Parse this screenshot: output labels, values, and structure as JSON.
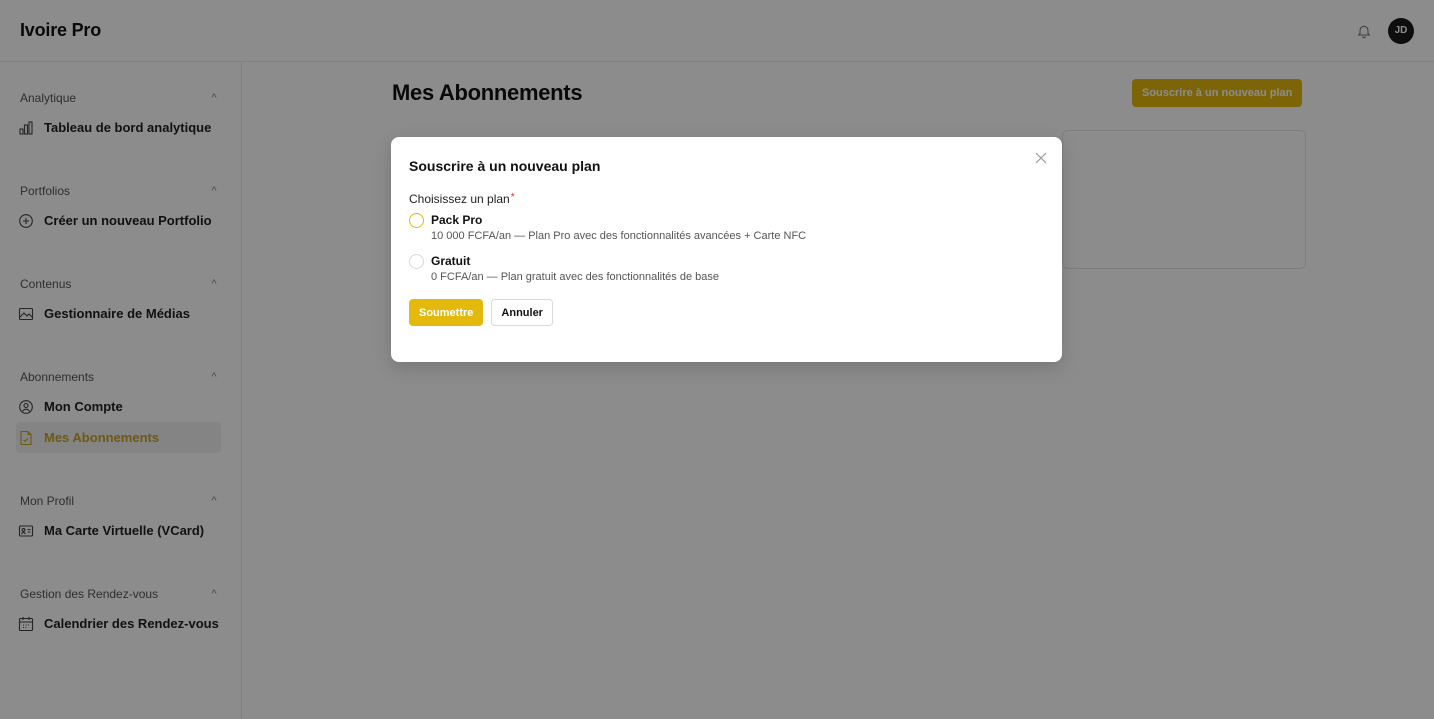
{
  "app": {
    "brand": "Ivoire Pro",
    "avatar_initials": "JD"
  },
  "sidebar": {
    "groups": [
      {
        "title": "Analytique",
        "items": [
          {
            "label": "Tableau de bord analytique",
            "icon": "bar-chart-icon"
          }
        ]
      },
      {
        "title": "Portfolios",
        "items": [
          {
            "label": "Créer un nouveau Portfolio",
            "icon": "plus-circle-icon"
          }
        ]
      },
      {
        "title": "Contenus",
        "items": [
          {
            "label": "Gestionnaire de Médias",
            "icon": "image-icon"
          }
        ]
      },
      {
        "title": "Abonnements",
        "items": [
          {
            "label": "Mon Compte",
            "icon": "user-circle-icon"
          },
          {
            "label": "Mes Abonnements",
            "icon": "document-icon",
            "active": true
          }
        ]
      },
      {
        "title": "Mon Profil",
        "items": [
          {
            "label": "Ma Carte Virtuelle (VCard)",
            "icon": "id-card-icon"
          }
        ]
      },
      {
        "title": "Gestion des Rendez-vous",
        "items": [
          {
            "label": "Calendrier des Rendez-vous",
            "icon": "calendar-icon"
          }
        ]
      }
    ]
  },
  "main": {
    "title": "Mes Abonnements",
    "primary_action": "Souscrire à un nouveau plan"
  },
  "modal": {
    "title": "Souscrire à un nouveau plan",
    "field_label": "Choisissez un plan",
    "required_mark": "*",
    "options": [
      {
        "name": "Pack Pro",
        "desc": "10 000 FCFA/an — Plan Pro avec des fonctionnalités avancées + Carte NFC"
      },
      {
        "name": "Gratuit",
        "desc": "0 FCFA/an — Plan gratuit avec des fonctionnalités de base"
      }
    ],
    "submit_label": "Soumettre",
    "cancel_label": "Annuler"
  },
  "colors": {
    "accent": "#e3b90d",
    "active_text": "#c9a227",
    "overlay": "rgba(0,0,0,0.45)"
  }
}
